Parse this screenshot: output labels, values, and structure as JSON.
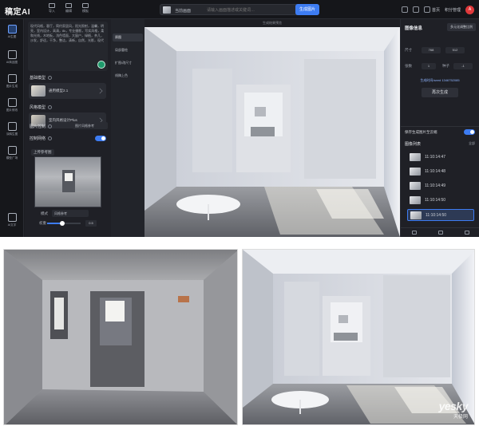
{
  "app": {
    "logo": "稿定AI",
    "top_tools": [
      "导入",
      "编辑",
      "模板"
    ],
    "url_bar": {
      "label": "当前画面",
      "placeholder": "请输入画面描述或关键词…"
    },
    "generate_label": "生成图片",
    "top_right": {
      "home_label": "首页",
      "credits": "积分管理",
      "avatar_initial": "A"
    },
    "nav_items": [
      {
        "label": "AI生图",
        "icon": "image-gen-icon"
      },
      {
        "label": "AI商品图",
        "icon": "product-icon"
      },
      {
        "label": "图片生成",
        "icon": "picture-icon"
      },
      {
        "label": "图片修改",
        "icon": "edit-icon"
      },
      {
        "label": "涂鸦生图",
        "icon": "sketch-icon"
      },
      {
        "label": "模型广场",
        "icon": "model-icon"
      },
      {
        "label": "AI文字",
        "icon": "text-icon"
      }
    ],
    "panel": {
      "prompt_text": "现代风格，客厅，简约家居风，阳光照射，温馨，明亮，室内设计，高清，8k，专业摄影，写实风格，柔和光线，木地板，浅色墙面，大窗户，绿植，茶几，沙发，舒适，干净，整洁，清新，自然，光影，现代",
      "base_model_title": "基础模型",
      "base_model_name": "通用模型2.1",
      "style_model_title": "风格模型",
      "style_model_name": "室内风格设计Plus",
      "image_ctrl_title": "图片控制",
      "image_ctrl_select": "图片风格参考",
      "control_net_title": "控制网络",
      "upload_label": "上传参考图",
      "mode_label": "模式",
      "mode_value": "风格参考",
      "weight_label": "权重",
      "weight_value": "0.5",
      "weight_fraction": 0.45
    },
    "mid_items": [
      "原图",
      "局部重绘",
      "扩图/改尺寸",
      "线稿上色"
    ],
    "canvas_caption": "生成结果预览",
    "right_panel": {
      "title": "图像信息",
      "action": "多元化调整比例",
      "size_label": "尺寸",
      "width": "768",
      "height": "512",
      "count_label": "张数",
      "count": "1",
      "seed_label": "种子",
      "seed": "-1",
      "regen_text": "生成时间/seed 1346752085",
      "regen_button": "再次生成",
      "auto_save_label": "保存生成图片至云端",
      "history_title": "图像列表",
      "history_filter": "全部",
      "history": [
        "11:10:14:47",
        "11:10:14:48",
        "11:10:14:49",
        "11:10:14:50",
        "11:10:14:50"
      ]
    }
  },
  "photos": {
    "watermark_main": "yesky",
    "watermark_sub": "天极网"
  },
  "colors": {
    "accent": "#3d7cf2",
    "app_bg": "#1c1d22",
    "success": "#1f9a6c"
  }
}
